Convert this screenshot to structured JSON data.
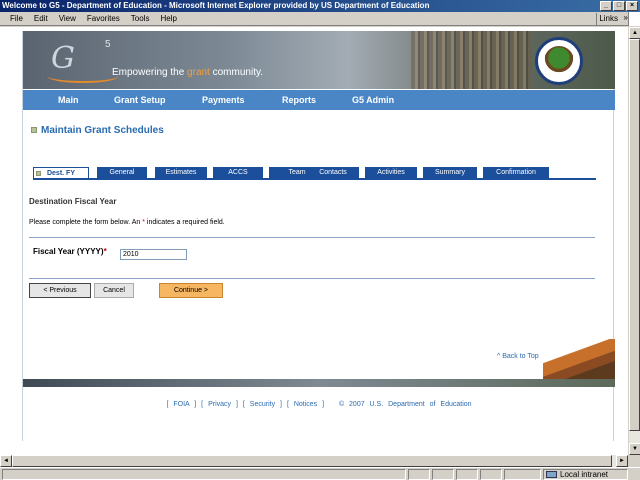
{
  "window": {
    "title": "Welcome to G5 - Department of Education - Microsoft Internet Explorer provided by US Department of Education",
    "menu": [
      "File",
      "Edit",
      "View",
      "Favorites",
      "Tools",
      "Help"
    ],
    "links_label": "Links",
    "links_chevron": "»",
    "status_zone": "Local intranet"
  },
  "banner": {
    "logo_text": "G",
    "logo_sup": "5",
    "tagline_pre": "Empowering the ",
    "tagline_grant": "grant",
    "tagline_post": " community."
  },
  "nav": [
    "Main",
    "Grant Setup",
    "Payments",
    "Reports",
    "G5 Admin"
  ],
  "page_title": "Maintain Grant Schedules",
  "tabs": [
    "Dest. FY",
    "General",
    "Estimates",
    "ACCS",
    "Team",
    "Contacts",
    "Activities",
    "Summary",
    "Confirmation"
  ],
  "form": {
    "section_heading": "Destination Fiscal Year",
    "instructions_pre": "Please complete the form below. An ",
    "instructions_req": "*",
    "instructions_post": " indicates a required field.",
    "fy_label": "Fiscal Year (YYYY)",
    "fy_req": "*",
    "fy_value": "2010"
  },
  "buttons": {
    "previous": "< Previous",
    "cancel": "Cancel",
    "continue": "Continue >"
  },
  "back_to_top": "^ Back to Top",
  "footer": {
    "foia": "FOIA",
    "privacy": "Privacy",
    "security": "Security",
    "notices": "Notices",
    "copyright": "© 2007 U.S. Department of Education"
  },
  "colors": {
    "nav_blue": "#4a86c6",
    "tab_blue": "#1c4f9b",
    "link_blue": "#2a6bb0",
    "continue_orange": "#f7b661",
    "required_red": "#cc0000"
  }
}
